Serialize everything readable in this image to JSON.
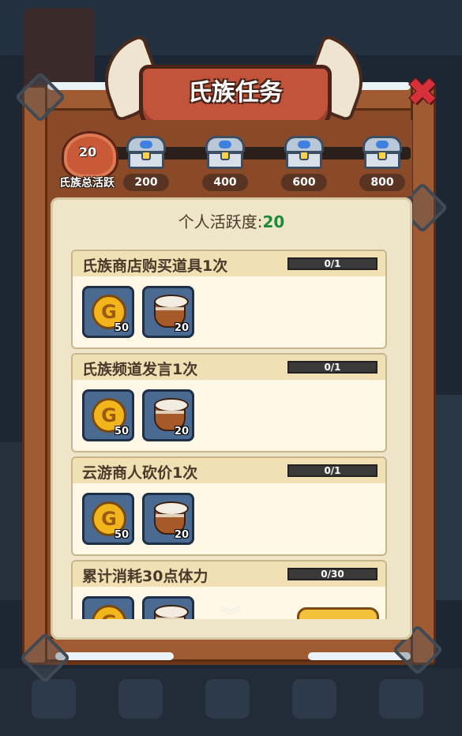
{
  "title": "氏族任务",
  "close_icon": "close-x-icon",
  "clan_total": {
    "value": "20",
    "label": "氏族总活跃"
  },
  "milestones": [
    {
      "value": "200",
      "icon": "treasure-chest-icon"
    },
    {
      "value": "400",
      "icon": "treasure-chest-icon"
    },
    {
      "value": "600",
      "icon": "treasure-chest-icon"
    },
    {
      "value": "800",
      "icon": "treasure-chest-icon"
    }
  ],
  "personal": {
    "label": "个人活跃度:",
    "value": "20"
  },
  "tasks": [
    {
      "name": "氏族商店购买道具1次",
      "progress_text": "0/1",
      "progress": 0,
      "rewards": [
        {
          "icon": "gold-coin-icon",
          "count": "50"
        },
        {
          "icon": "war-drum-icon",
          "count": "20"
        }
      ]
    },
    {
      "name": "氏族频道发言1次",
      "progress_text": "0/1",
      "progress": 0,
      "rewards": [
        {
          "icon": "gold-coin-icon",
          "count": "50"
        },
        {
          "icon": "war-drum-icon",
          "count": "20"
        }
      ]
    },
    {
      "name": "云游商人砍价1次",
      "progress_text": "0/1",
      "progress": 0,
      "rewards": [
        {
          "icon": "gold-coin-icon",
          "count": "50"
        },
        {
          "icon": "war-drum-icon",
          "count": "20"
        }
      ]
    },
    {
      "name": "累计消耗30点体力",
      "progress_text": "0/30",
      "progress": 0,
      "rewards": [
        {
          "icon": "gold-coin-icon",
          "count": ""
        },
        {
          "icon": "war-drum-icon",
          "count": ""
        }
      ],
      "button_label": ""
    }
  ],
  "scroll_hint_icon": "chevron-down-icon",
  "colors": {
    "accent_green": "#1f8a3a",
    "banner_red": "#c2543b",
    "close_red": "#d6303a",
    "progress_fill": "#e8a41a"
  }
}
